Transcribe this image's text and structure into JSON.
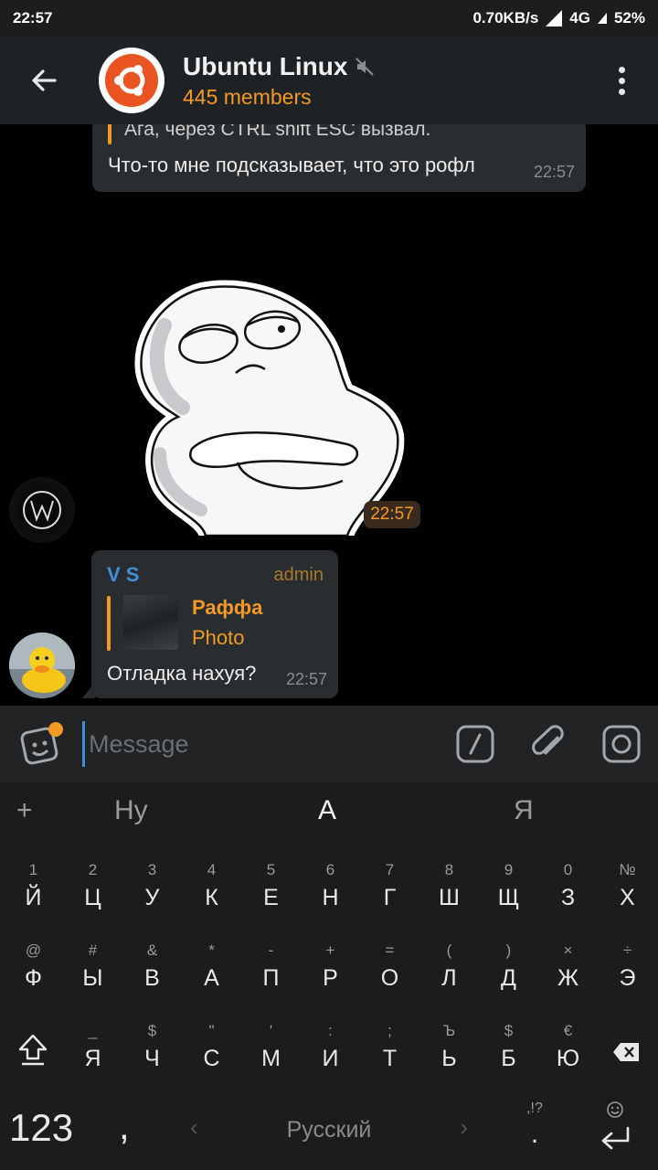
{
  "status": {
    "time": "22:57",
    "speed": "0.70KB/s",
    "network": "4G",
    "battery": "52%"
  },
  "header": {
    "title": "Ubuntu Linux",
    "members": "445 members"
  },
  "messages": {
    "m1": {
      "reply": "Ага, через CTRL shift ESC вызвал.",
      "text": "Что-то мне подсказывает, что это рофл",
      "time": "22:57"
    },
    "sticker": {
      "time": "22:57"
    },
    "m2": {
      "sender": "V S",
      "role": "admin",
      "reply_name": "Раффа",
      "reply_type": "Photo",
      "text": "Отладка нахуя?",
      "time": "22:57"
    }
  },
  "input": {
    "placeholder": "Message"
  },
  "keyboard": {
    "suggestions": [
      "+",
      "Ну",
      "А",
      "Я"
    ],
    "row1": [
      [
        "1",
        "Й"
      ],
      [
        "2",
        "Ц"
      ],
      [
        "3",
        "У"
      ],
      [
        "4",
        "К"
      ],
      [
        "5",
        "Е"
      ],
      [
        "6",
        "Н"
      ],
      [
        "7",
        "Г"
      ],
      [
        "8",
        "Ш"
      ],
      [
        "9",
        "Щ"
      ],
      [
        "0",
        "З"
      ],
      [
        "№",
        "Х"
      ]
    ],
    "row2": [
      [
        "@",
        "Ф"
      ],
      [
        "#",
        "Ы"
      ],
      [
        "&",
        "В"
      ],
      [
        "*",
        "А"
      ],
      [
        "-",
        "П"
      ],
      [
        "+",
        "Р"
      ],
      [
        "=",
        "О"
      ],
      [
        "(",
        "Л"
      ],
      [
        ")",
        "Д"
      ],
      [
        "×",
        "Ж"
      ],
      [
        "÷",
        "Э"
      ]
    ],
    "row3": [
      [
        "_",
        "Я"
      ],
      [
        "$",
        "Ч"
      ],
      [
        "\"",
        "С"
      ],
      [
        "'",
        "М"
      ],
      [
        ":",
        "И"
      ],
      [
        ";",
        "Т"
      ],
      [
        "Ъ",
        "Ь"
      ],
      [
        "$",
        "Б"
      ],
      [
        "€",
        "Ю"
      ]
    ],
    "bottom": {
      "numbers": "123",
      "comma": ",",
      "language": "Русский",
      "punct_top": ",!?",
      "punct": "."
    }
  },
  "colors": {
    "accent": "#f39a24",
    "link": "#3f8fd8",
    "bubble": "#2a2d30"
  }
}
